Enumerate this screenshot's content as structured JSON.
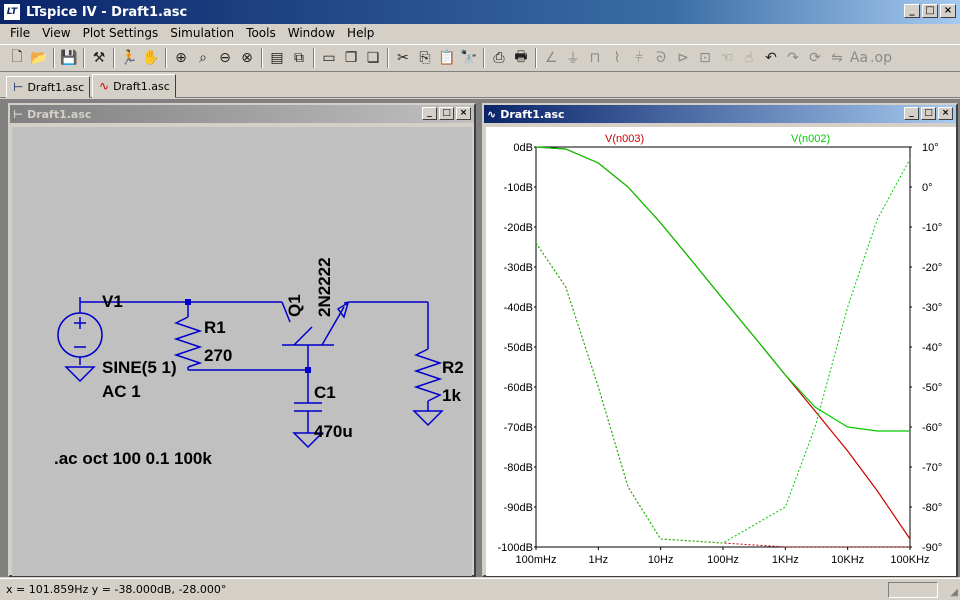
{
  "window": {
    "title": "LTspice IV - Draft1.asc",
    "icon_text": "LT"
  },
  "menu": [
    "File",
    "View",
    "Plot Settings",
    "Simulation",
    "Tools",
    "Window",
    "Help"
  ],
  "tabs": [
    {
      "label": "Draft1.asc",
      "type": "schematic"
    },
    {
      "label": "Draft1.asc",
      "type": "waveform"
    }
  ],
  "schematic_window": {
    "title": "Draft1.asc",
    "components": {
      "v1": {
        "name": "V1",
        "value": "SINE(5 1)",
        "ac": "AC 1"
      },
      "r1": {
        "name": "R1",
        "value": "270"
      },
      "q1": {
        "name": "Q1",
        "value": "2N2222"
      },
      "c1": {
        "name": "C1",
        "value": "470u"
      },
      "r2": {
        "name": "R2",
        "value": "1k"
      }
    },
    "directive": ".ac oct 100 0.1 100k"
  },
  "plot_window": {
    "title": "Draft1.asc",
    "trace_labels": [
      {
        "name": "V(n003)",
        "color": "#cc0000"
      },
      {
        "name": "V(n002)",
        "color": "#00cc00"
      }
    ],
    "y_left_ticks": [
      "0dB",
      "-10dB",
      "-20dB",
      "-30dB",
      "-40dB",
      "-50dB",
      "-60dB",
      "-70dB",
      "-80dB",
      "-90dB",
      "-100dB"
    ],
    "y_right_ticks": [
      "10°",
      "0°",
      "-10°",
      "-20°",
      "-30°",
      "-40°",
      "-50°",
      "-60°",
      "-70°",
      "-80°",
      "-90°"
    ],
    "x_ticks": [
      "100mHz",
      "1Hz",
      "10Hz",
      "100Hz",
      "1KHz",
      "10KHz",
      "100KHz"
    ]
  },
  "status": {
    "cursor_text": "x = 101.859Hz    y = -38.000dB, -28.000°"
  },
  "colors": {
    "wire": "#0000cc",
    "trace_red": "#cc0000",
    "trace_green": "#00cc00",
    "schematic_bg": "#c0c0c0"
  },
  "chart_data": {
    "type": "line",
    "x_scale": "log",
    "xlim": [
      "100mHz",
      "100KHz"
    ],
    "ylim_left": [
      -100,
      0
    ],
    "ylim_right": [
      -90,
      10
    ],
    "ylabel_left_unit": "dB",
    "ylabel_right_unit": "°",
    "grid": false,
    "x": [
      0.1,
      0.3,
      1,
      3,
      10,
      30,
      100,
      300,
      1000,
      3000,
      10000,
      30000,
      100000
    ],
    "series": [
      {
        "name": "V(n003)",
        "values": [
          0,
          -0.5,
          -4,
          -10,
          -19,
          -28,
          -38,
          -47,
          -57,
          -66,
          -76,
          -86,
          -98
        ]
      },
      {
        "name": "V(n002)",
        "values": [
          0,
          -0.5,
          -4,
          -10,
          -19,
          -28,
          -38,
          -47,
          -57,
          -65,
          -70,
          -71,
          -71
        ]
      }
    ]
  }
}
